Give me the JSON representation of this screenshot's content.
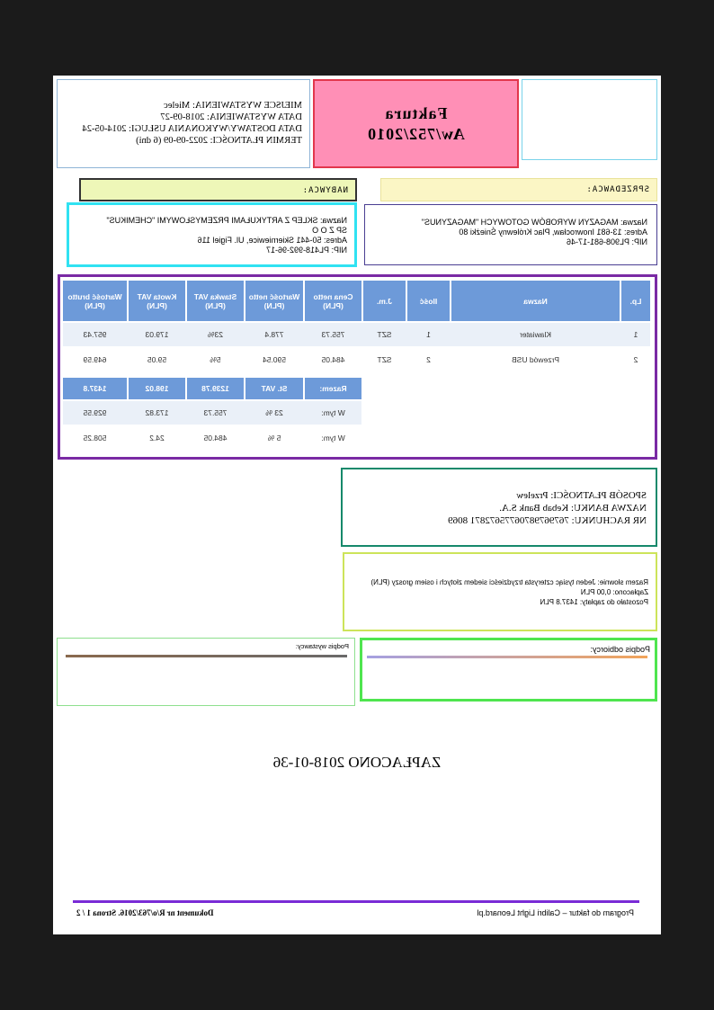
{
  "header": {
    "title": "Faktura",
    "number": "Aw/752/2010",
    "place_lines": [
      "MIEJSCE WYSTAWIENIA: Mielec",
      "DATA WYSTAWIENIA: 2018-09-27",
      "DATA DOSTAWY/WYKONANIA USŁUGI: 2014-05-24",
      "TERMIN PŁATNOŚCI: 2022-09-09 (6 dni)"
    ]
  },
  "seller": {
    "label": "SPRZEDAWCA:",
    "lines": [
      "Nazwa: MAGAZYN WYROBÓW GOTOWYCH \"MAGAZYNUS\"",
      "Adres: 13-681 Inowrocław, Plac Królewny Śnieżki 80",
      "NIP: PL908-681-17-46"
    ]
  },
  "buyer": {
    "label": "NABYWCA:",
    "lines": [
      "Nazwa: SKLEP Z ARTYKUŁAMI PRZEMYSŁOWYMI \"CHEMIKUS\"",
      "SP Z O O",
      "Adres: 50-441 Skierniewice, Ul. Figiel 116",
      "NIP: PL418-992-96-17"
    ]
  },
  "table": {
    "headers": [
      "Lp.",
      "Nazwa",
      "Ilość",
      "J.m.",
      "Cena netto (PLN)",
      "Wartość netto (PLN)",
      "Stawka VAT (PLN)",
      "Kwota VAT (PLN)",
      "Wartość brutto (PLN)"
    ],
    "rows": [
      [
        "1",
        "Klawiater",
        "1",
        "SZT",
        "755.73",
        "778.4",
        "23%",
        "179.03",
        "957.43"
      ],
      [
        "2",
        "Przewód USB",
        "2",
        "SZT",
        "484.05",
        "590.54",
        "5%",
        "59.05",
        "649.59"
      ]
    ],
    "summary_header": [
      "Razem:",
      "St. VAT",
      "1239.78",
      "198.02",
      "1437.8"
    ],
    "summary_rows": [
      [
        "W tym:",
        "23 %",
        "755.73",
        "173.82",
        "929.55"
      ],
      [
        "W tym:",
        "5 %",
        "484.05",
        "24.2",
        "508.25"
      ]
    ]
  },
  "payment": {
    "method": "SPOSÓB  PŁATNOŚCI: Przelew",
    "bank": "NAZWA BANKU: Kebab Bank S.A.",
    "account": "NR RACHUNKU: 76796798706775672871 8069"
  },
  "amount_words": {
    "line1": "Razem słownie: Jeden tysiąc czterysta trzydzieści siedem złotych i osiem groszy (PLN)",
    "line2": "Zapłacono: 0,00 PLN",
    "line3": "Pozostało do zapłaty: 1437.8 PLN"
  },
  "signatures": {
    "receiver_label": "Podpis odbiorcy:",
    "issuer_label": "Podpis wystawcy:"
  },
  "paid_stamp": "ZAPŁACONO 2018-01-36",
  "footer": {
    "left": "Program do faktur – Calibri Light Leonard.pl",
    "right": "Dokument nr R/o/763/2016. Strona 1 / 2"
  },
  "colors": {
    "title_bg": "#ff8fb6",
    "table_header": "#6d9ad9",
    "table_border": "#7a2aa4",
    "footer_line": "#7a2bd6"
  }
}
